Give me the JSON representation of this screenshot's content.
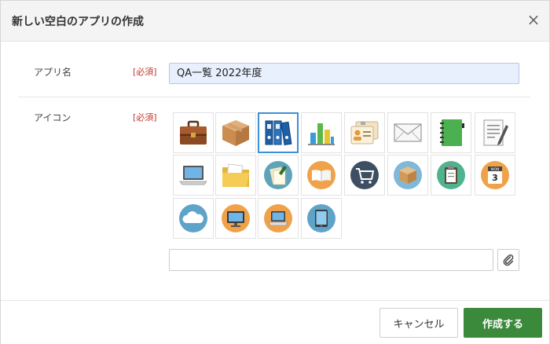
{
  "dialog": {
    "title": "新しい空白のアプリの作成",
    "close_glyph": "×"
  },
  "form": {
    "app_name_label": "アプリ名",
    "app_name_required": "[必須]",
    "app_name_value": "QA一覧  2022年度",
    "icon_label": "アイコン",
    "icon_required": "[必須]",
    "selected_icon": "binders-icon",
    "icons": [
      "briefcase-icon",
      "cardboard-box-icon",
      "binders-icon",
      "bar-chart-icon",
      "id-cards-icon",
      "envelope-icon",
      "green-notebook-icon",
      "document-pen-icon",
      "laptop-icon",
      "folder-icon",
      "document-circle-icon",
      "open-book-icon",
      "shopping-cart-icon",
      "box-circle-icon",
      "clipboard-icon",
      "calendar-icon",
      "cloud-icon",
      "monitor-icon",
      "laptop-circle-icon",
      "tablet-icon"
    ],
    "calendar_month": "MON",
    "calendar_day": "3"
  },
  "footer": {
    "cancel_label": "キャンセル",
    "create_label": "作成する"
  },
  "colors": {
    "accent_green": "#3b8a3b",
    "selected_border": "#3d8fd6",
    "required_red": "#c0392b",
    "input_fill": "#e8f0fe"
  }
}
